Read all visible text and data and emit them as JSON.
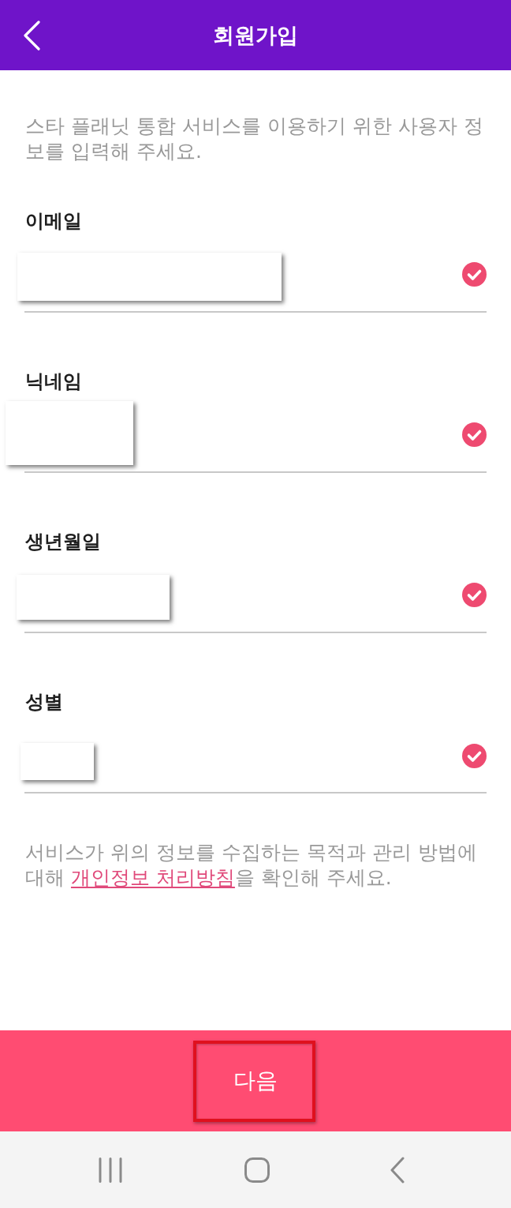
{
  "header": {
    "title": "회원가입"
  },
  "intro": "스타 플래닛 통합 서비스를 이용하기 위한 사용자 정보를 입력해 주세요.",
  "fields": [
    {
      "label": "이메일",
      "redacted": true,
      "valid": true
    },
    {
      "label": "닉네임",
      "redacted": true,
      "valid": true
    },
    {
      "label": "생년월일",
      "redacted": true,
      "valid": true
    },
    {
      "label": "성별",
      "redacted": true,
      "valid": true
    }
  ],
  "privacy_notice": {
    "text_before": "서비스가 위의 정보를 수집하는 목적과 관리 방법에 대해",
    "link": "개인정보 처리방침",
    "text_after": "을 확인해 주세요."
  },
  "next_button": {
    "label": "다음",
    "highlighted": true
  }
}
